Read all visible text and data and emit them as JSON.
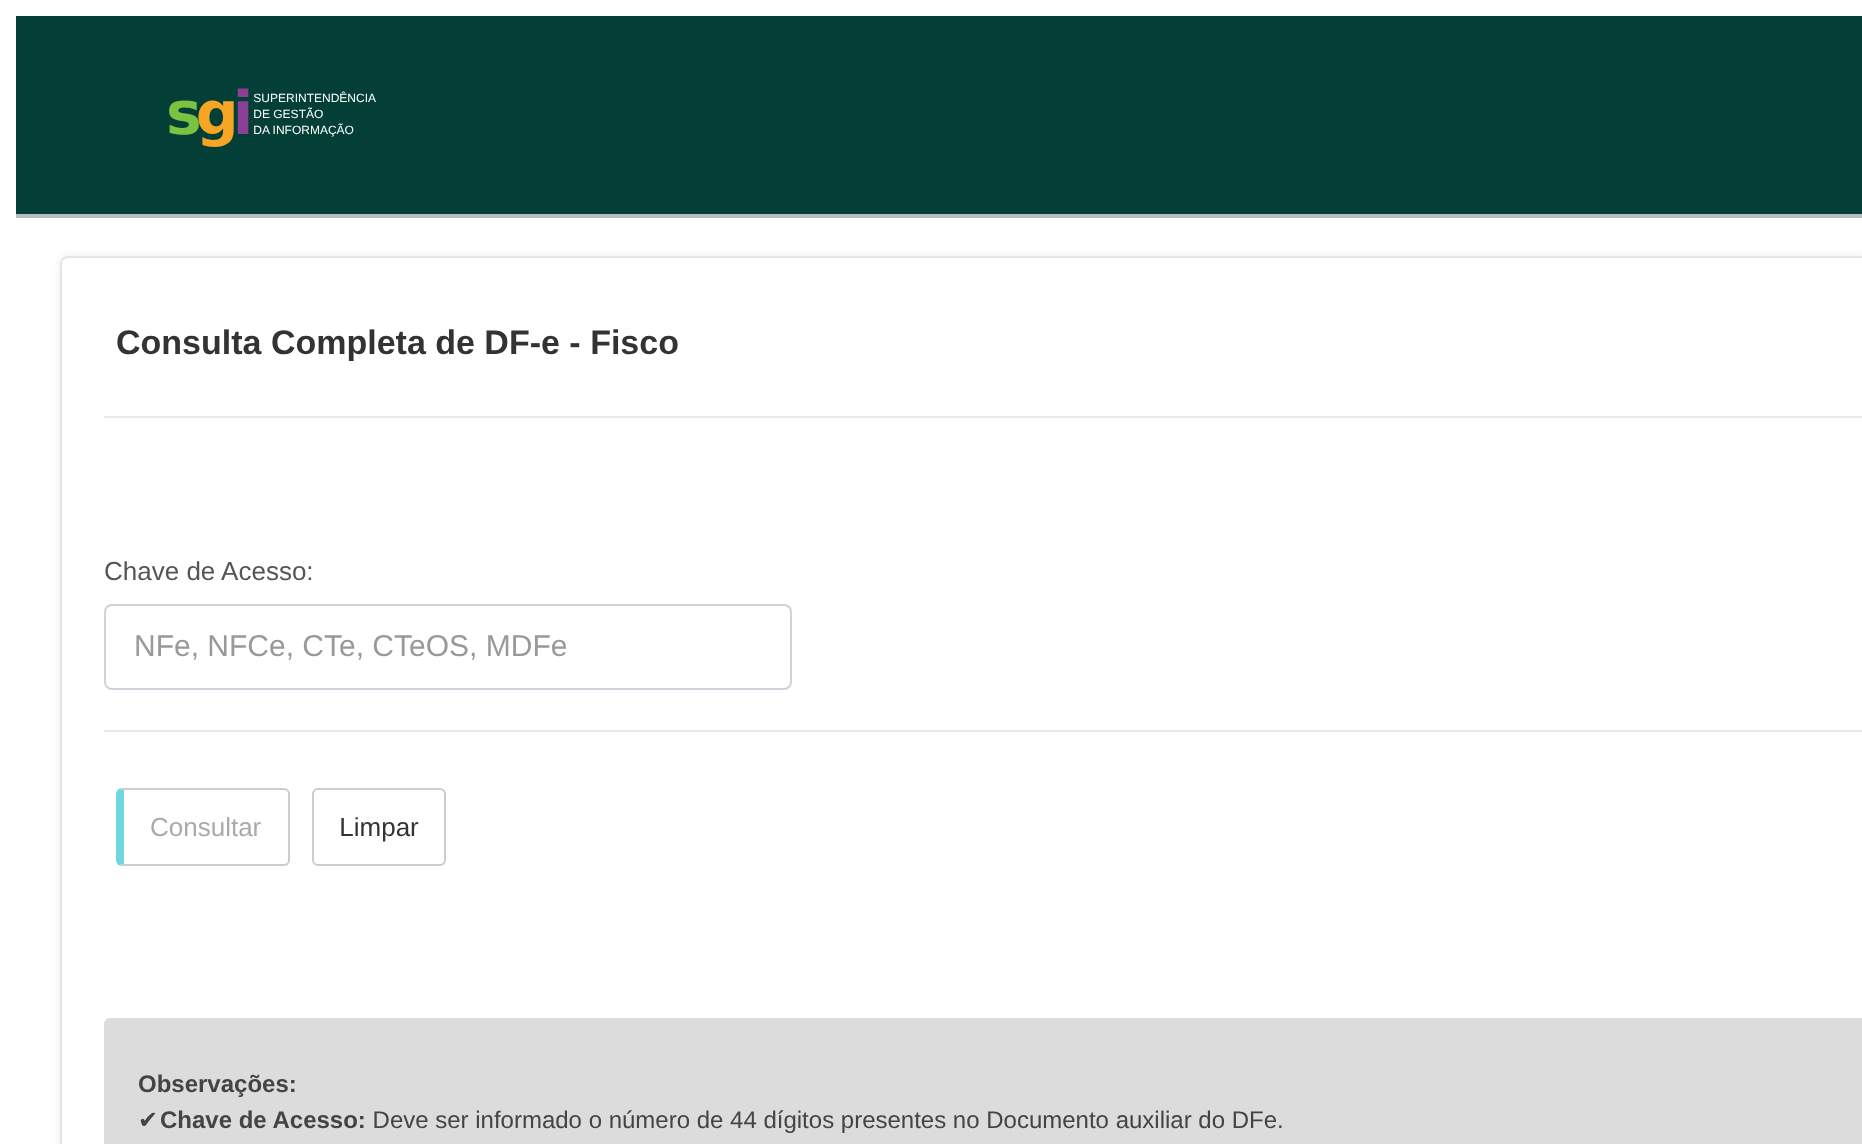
{
  "header": {
    "logo_mark": "sgi",
    "logo_lines": [
      "SUPERINTENDÊNCIA",
      "DE GESTÃO",
      "DA INFORMAÇÃO"
    ]
  },
  "card": {
    "title": "Consulta Completa de DF-e - Fisco",
    "field": {
      "label": "Chave de Acesso:",
      "placeholder": "NFe, NFCe, CTe, CTeOS, MDFe"
    },
    "buttons": [
      {
        "label": "Consultar",
        "disabled": true
      },
      {
        "label": "Limpar",
        "disabled": false
      }
    ],
    "notes": {
      "title": "Observações:",
      "items": [
        {
          "bullet": "✔",
          "text": "**Chave de Acesso:** Deve ser informado o número de 44 dígitos presentes no Documento auxiliar do DFe."
        }
      ]
    }
  }
}
